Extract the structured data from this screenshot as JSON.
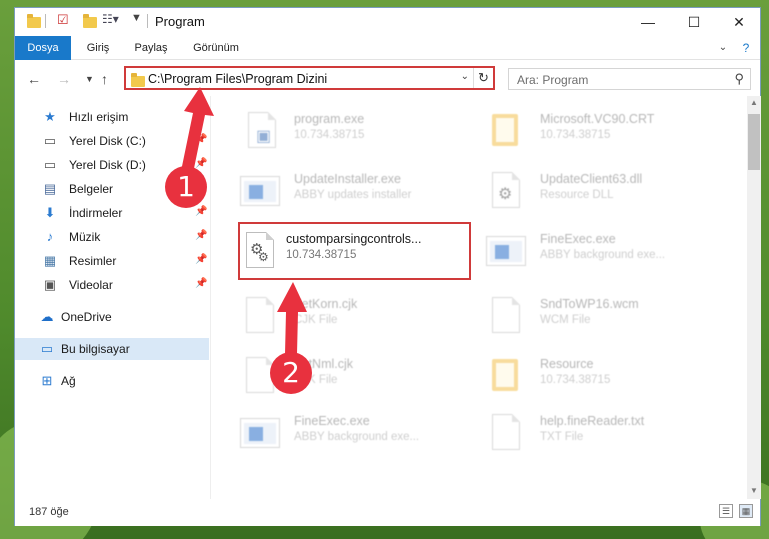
{
  "window": {
    "title": "Program",
    "controls": {
      "minimize": "—",
      "maximize": "☐",
      "close": "✕"
    }
  },
  "ribbon": {
    "tabs": [
      "Dosya",
      "Giriş",
      "Paylaş",
      "Görünüm"
    ],
    "active_tab": "Dosya"
  },
  "address": {
    "path": "C:\\Program Files\\Program Dizini",
    "search_placeholder": "Ara: Program"
  },
  "sidebar": {
    "items": [
      {
        "label": "Hızlı erişim",
        "icon": "star-icon",
        "pinned": false
      },
      {
        "label": "Yerel Disk (C:)",
        "icon": "drive-icon",
        "pinned": true
      },
      {
        "label": "Yerel Disk (D:)",
        "icon": "drive-icon",
        "pinned": true
      },
      {
        "label": "Belgeler",
        "icon": "documents-icon",
        "pinned": true
      },
      {
        "label": "İndirmeler",
        "icon": "download-icon",
        "pinned": true
      },
      {
        "label": "Müzik",
        "icon": "music-icon",
        "pinned": true
      },
      {
        "label": "Resimler",
        "icon": "pictures-icon",
        "pinned": true
      },
      {
        "label": "Videolar",
        "icon": "videos-icon",
        "pinned": true
      },
      {
        "label": "OneDrive",
        "icon": "cloud-icon",
        "pinned": false
      },
      {
        "label": "Bu bilgisayar",
        "icon": "computer-icon",
        "pinned": false
      },
      {
        "label": "Ağ",
        "icon": "network-icon",
        "pinned": false
      }
    ],
    "selected": "Bu bilgisayar"
  },
  "files": [
    {
      "name": "program.exe",
      "sub": "10.734.38715",
      "icon": "app-icon"
    },
    {
      "name": "Microsoft.VC90.CRT",
      "sub": "10.734.38715",
      "icon": "folder-icon"
    },
    {
      "name": "UpdateInstaller.exe",
      "sub": "ABBY updates installer",
      "icon": "exe-icon"
    },
    {
      "name": "UpdateClient63.dll",
      "sub": "Resource DLL",
      "icon": "dll-icon"
    },
    {
      "name": "customparsingcontrols...",
      "sub": "10.734.38715",
      "icon": "settings-file-icon"
    },
    {
      "name": "FineExec.exe",
      "sub": "ABBY background exe...",
      "icon": "exe-icon"
    },
    {
      "name": "FetKorn.cjk",
      "sub": "CJK File",
      "icon": "file-icon"
    },
    {
      "name": "SndToWP16.wcm",
      "sub": "WCM File",
      "icon": "file-icon"
    },
    {
      "name": "FetNml.cjk",
      "sub": "CJK File",
      "icon": "file-icon"
    },
    {
      "name": "Resource",
      "sub": "10.734.38715",
      "icon": "folder-icon"
    },
    {
      "name": "FineExec.exe",
      "sub": "ABBY background exe...",
      "icon": "exe-icon"
    },
    {
      "name": "help.fineReader.txt",
      "sub": "TXT File",
      "icon": "file-icon"
    }
  ],
  "status": {
    "item_count": "187 öğe"
  },
  "annotations": {
    "badge_1": "1",
    "badge_2": "2"
  },
  "colors": {
    "accent": "#1979ca",
    "highlight_red": "#d03a3a",
    "arrow_red": "#e8313e"
  }
}
